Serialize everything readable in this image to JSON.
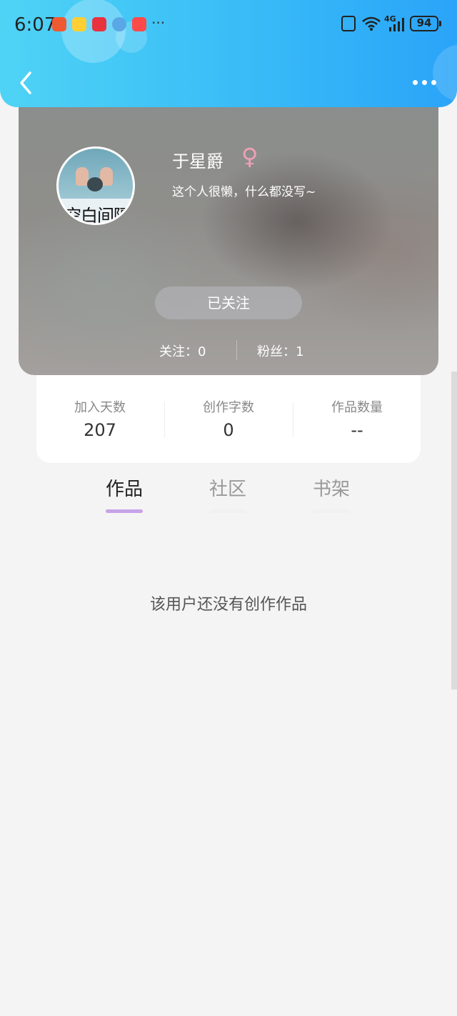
{
  "status_bar": {
    "time": "6:07",
    "notifications": [
      "call-missed-icon",
      "weibo-icon",
      "news-icon",
      "bubble-app-icon",
      "store-icon"
    ],
    "more": "···",
    "network": "4G",
    "battery": "94"
  },
  "header": {
    "back_icon": "chevron-left-icon",
    "more_icon": "more-horizontal-icon"
  },
  "profile": {
    "avatar_text": "空白间隔",
    "username": "于星爵",
    "gender_symbol": "♀",
    "bio": "这个人很懒，什么都没写~",
    "follow_button_label": "已关注",
    "following_text": "关注：0",
    "fans_text": "粉丝：1"
  },
  "stats": [
    {
      "label": "加入天数",
      "value": "207"
    },
    {
      "label": "创作字数",
      "value": "0"
    },
    {
      "label": "作品数量",
      "value": "--"
    }
  ],
  "tabs": [
    {
      "label": "作品",
      "active": true
    },
    {
      "label": "社区",
      "active": false
    },
    {
      "label": "书架",
      "active": false
    }
  ],
  "empty_message": "该用户还没有创作作品",
  "colors": {
    "header_start": "#4fd3f5",
    "header_end": "#2aa4f8",
    "active_tab_indicator": "#c6a3e8",
    "gender_female": "#f0a0b4"
  }
}
